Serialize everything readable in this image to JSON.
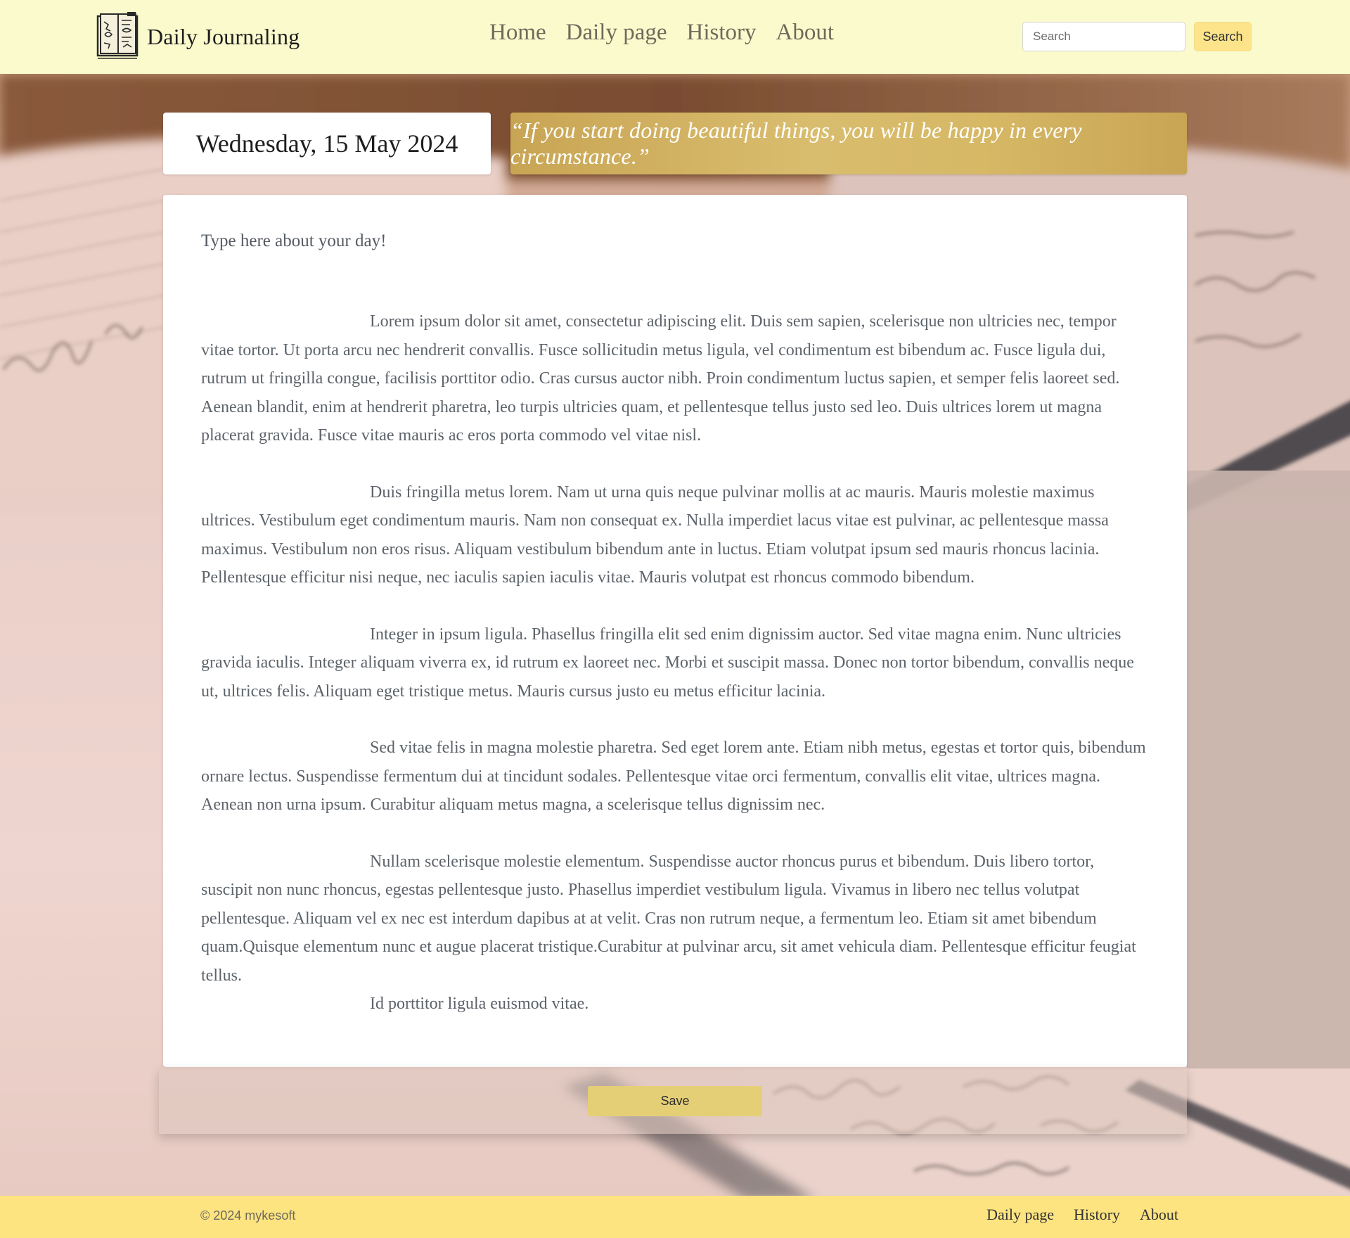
{
  "navbar": {
    "brand_name": "Daily Journaling",
    "brand_icon": "journal-book-icon",
    "links": [
      "Home",
      "Daily page",
      "History",
      "About"
    ],
    "search_placeholder": "Search",
    "search_button": "Search"
  },
  "journal": {
    "date": "Wednesday, 15 May 2024",
    "quote": "“If you start doing beautiful things, you will be happy in every circumstance.”",
    "prompt": "Type here about your day!",
    "paragraphs": [
      "Lorem ipsum dolor sit amet, consectetur adipiscing elit. Duis sem sapien, scelerisque non ultricies nec, tempor vitae tortor. Ut porta arcu nec hendrerit convallis. Fusce sollicitudin metus ligula, vel condimentum est bibendum ac. Fusce ligula dui, rutrum ut fringilla congue, facilisis porttitor odio. Cras cursus auctor nibh. Proin condimentum luctus sapien, et semper felis laoreet sed. Aenean blandit, enim at hendrerit pharetra, leo turpis ultricies quam, et pellentesque tellus justo sed leo. Duis ultrices lorem ut magna placerat gravida. Fusce vitae mauris ac eros porta commodo vel vitae nisl.",
      "Duis fringilla metus lorem. Nam ut urna quis neque pulvinar mollis at ac mauris. Mauris molestie maximus ultrices. Vestibulum eget condimentum mauris. Nam non consequat ex. Nulla imperdiet lacus vitae est pulvinar, ac pellentesque massa maximus. Vestibulum non eros risus. Aliquam vestibulum bibendum ante in luctus. Etiam volutpat ipsum sed mauris rhoncus lacinia. Pellentesque efficitur nisi neque, nec iaculis sapien iaculis vitae. Mauris volutpat est rhoncus commodo bibendum.",
      "Integer in ipsum ligula. Phasellus fringilla elit sed enim dignissim auctor. Sed vitae magna enim. Nunc ultricies gravida iaculis. Integer aliquam viverra ex, id rutrum ex laoreet nec. Morbi et suscipit massa. Donec non tortor bibendum, convallis neque ut, ultrices felis. Aliquam eget tristique metus. Mauris cursus justo eu metus efficitur lacinia.",
      "Sed vitae felis in magna molestie pharetra. Sed eget lorem ante. Etiam nibh metus, egestas et tortor quis, bibendum ornare lectus. Suspendisse fermentum dui at tincidunt sodales. Pellentesque vitae orci fermentum, convallis elit vitae, ultrices magna. Aenean non urna ipsum. Curabitur aliquam metus magna, a scelerisque tellus dignissim nec.",
      "Nullam scelerisque molestie elementum. Suspendisse auctor rhoncus purus et bibendum. Duis libero tortor, suscipit non nunc rhoncus, egestas pellentesque justo. Phasellus imperdiet vestibulum ligula. Vivamus in libero nec tellus volutpat pellentesque. Aliquam vel ex nec est interdum dapibus at at velit. Cras non rutrum neque, a fermentum leo. Etiam sit amet bibendum quam.Quisque elementum nunc et augue placerat tristique.Curabitur at pulvinar arcu, sit amet vehicula diam. Pellentesque efficitur feugiat tellus.",
      "Id porttitor ligula euismod vitae."
    ],
    "save_button": "Save"
  },
  "footer": {
    "copyright": "© 2024 mykesoft",
    "links": [
      "Daily page",
      "History",
      "About"
    ]
  },
  "colors": {
    "navbar_bg": "#fafacd",
    "footer_bg": "#fde480",
    "search_button_bg": "#fde48a",
    "quote_gold": "#d4b463",
    "save_button_bg": "#e5cf76"
  }
}
